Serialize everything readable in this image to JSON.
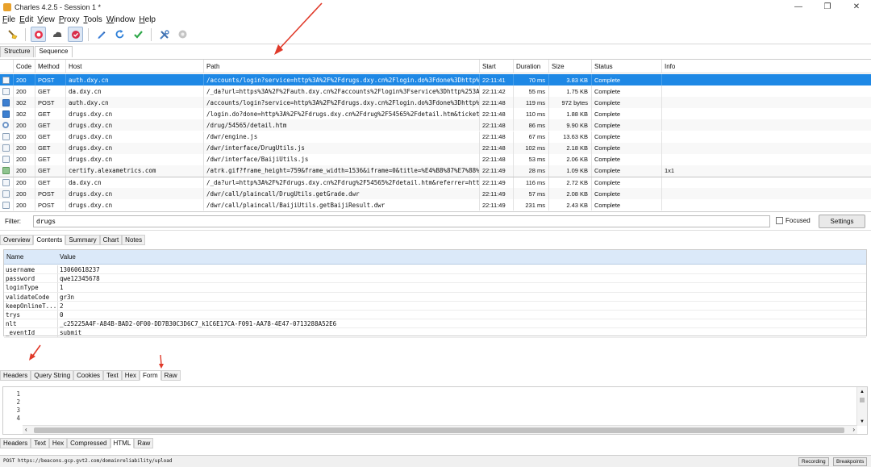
{
  "window": {
    "title": "Charles 4.2.5 - Session 1 *"
  },
  "menu": [
    {
      "key": "F",
      "rest": "ile"
    },
    {
      "key": "E",
      "rest": "dit"
    },
    {
      "key": "V",
      "rest": "iew"
    },
    {
      "key": "P",
      "rest": "roxy"
    },
    {
      "key": "T",
      "rest": "ools"
    },
    {
      "key": "W",
      "rest": "indow"
    },
    {
      "key": "H",
      "rest": "elp"
    }
  ],
  "toolbar": {
    "icons": [
      "broom-icon",
      "record-icon",
      "throttle-icon",
      "breakpoint-icon",
      "pen-icon",
      "refresh-icon",
      "check-icon",
      "tools-icon",
      "settings-icon"
    ]
  },
  "view_tabs": [
    "Structure",
    "Sequence"
  ],
  "sequence": {
    "columns": [
      "Code",
      "Method",
      "Host",
      "Path",
      "Start",
      "Duration",
      "Size",
      "Status",
      "Info"
    ],
    "rows": [
      {
        "icon": "doc",
        "code": "200",
        "method": "POST",
        "host": "auth.dxy.cn",
        "path": "/accounts/login?service=http%3A%2F%2Fdrugs.dxy.cn%2Flogin.do%3Fdone%3Dhttp%",
        "start": "22:11:41",
        "duration": "70 ms",
        "size": "3.83 KB",
        "status": "Complete",
        "info": ""
      },
      {
        "icon": "doc",
        "code": "200",
        "method": "GET",
        "host": "da.dxy.cn",
        "path": "/_da?url=https%3A%2F%2Fauth.dxy.cn%2Faccounts%2Flogin%3Fservice%3Dhttp%253A",
        "start": "22:11:42",
        "duration": "55 ms",
        "size": "1.75 KB",
        "status": "Complete",
        "info": ""
      },
      {
        "icon": "redirect",
        "code": "302",
        "method": "POST",
        "host": "auth.dxy.cn",
        "path": "/accounts/login?service=http%3A%2F%2Fdrugs.dxy.cn%2Flogin.do%3Fdone%3Dhttp%",
        "start": "22:11:48",
        "duration": "119 ms",
        "size": "972 bytes",
        "status": "Complete",
        "info": ""
      },
      {
        "icon": "redirect",
        "code": "302",
        "method": "GET",
        "host": "drugs.dxy.cn",
        "path": "/login.do?done=http%3A%2F%2Fdrugs.dxy.cn%2Fdrug%2F54565%2Fdetail.htm&ticket=",
        "start": "22:11:48",
        "duration": "110 ms",
        "size": "1.88 KB",
        "status": "Complete",
        "info": ""
      },
      {
        "icon": "gear",
        "code": "200",
        "method": "GET",
        "host": "drugs.dxy.cn",
        "path": "/drug/54565/detail.htm",
        "start": "22:11:48",
        "duration": "86 ms",
        "size": "9.90 KB",
        "status": "Complete",
        "info": ""
      },
      {
        "icon": "doc",
        "code": "200",
        "method": "GET",
        "host": "drugs.dxy.cn",
        "path": "/dwr/engine.js",
        "start": "22:11:48",
        "duration": "67 ms",
        "size": "13.63 KB",
        "status": "Complete",
        "info": ""
      },
      {
        "icon": "doc",
        "code": "200",
        "method": "GET",
        "host": "drugs.dxy.cn",
        "path": "/dwr/interface/DrugUtils.js",
        "start": "22:11:48",
        "duration": "102 ms",
        "size": "2.18 KB",
        "status": "Complete",
        "info": ""
      },
      {
        "icon": "doc",
        "code": "200",
        "method": "GET",
        "host": "drugs.dxy.cn",
        "path": "/dwr/interface/BaijiUtils.js",
        "start": "22:11:48",
        "duration": "53 ms",
        "size": "2.06 KB",
        "status": "Complete",
        "info": ""
      },
      {
        "icon": "image",
        "code": "200",
        "method": "GET",
        "host": "certify.alexametrics.com",
        "path": "/atrk.gif?frame_height=759&frame_width=1536&iframe=0&title=%E4%B8%87%E7%88%",
        "start": "22:11:49",
        "duration": "28 ms",
        "size": "1.09 KB",
        "status": "Complete",
        "info": "1x1"
      },
      {
        "icon": "doc",
        "code": "200",
        "method": "GET",
        "host": "da.dxy.cn",
        "path": "/_da?url=http%3A%2F%2Fdrugs.dxy.cn%2Fdrug%2F54565%2Fdetail.htm&referrer=http",
        "start": "22:11:49",
        "duration": "116 ms",
        "size": "2.72 KB",
        "status": "Complete",
        "info": ""
      },
      {
        "icon": "doc",
        "code": "200",
        "method": "POST",
        "host": "drugs.dxy.cn",
        "path": "/dwr/call/plaincall/DrugUtils.getGrade.dwr",
        "start": "22:11:49",
        "duration": "57 ms",
        "size": "2.08 KB",
        "status": "Complete",
        "info": ""
      },
      {
        "icon": "doc",
        "code": "200",
        "method": "POST",
        "host": "drugs.dxy.cn",
        "path": "/dwr/call/plaincall/BaijiUtils.getBaijiResult.dwr",
        "start": "22:11:49",
        "duration": "231 ms",
        "size": "2.43 KB",
        "status": "Complete",
        "info": ""
      }
    ]
  },
  "filter": {
    "label": "Filter:",
    "value": "drugs",
    "focused_label": "Focused",
    "settings_label": "Settings"
  },
  "detail_tabs": [
    "Overview",
    "Contents",
    "Summary",
    "Chart",
    "Notes"
  ],
  "form": {
    "headers": [
      "Name",
      "Value"
    ],
    "rows": [
      {
        "name": "username",
        "value": "13060618237"
      },
      {
        "name": "password",
        "value": "qwe12345678"
      },
      {
        "name": "loginType",
        "value": "1"
      },
      {
        "name": "validateCode",
        "value": "gr3n"
      },
      {
        "name": "keepOnlineT...",
        "value": "2"
      },
      {
        "name": "trys",
        "value": "0"
      },
      {
        "name": "nlt",
        "value": "_c25225A4F-A84B-BAD2-0F00-DD7B30C3D6C7_k1C6E17CA-F091-AA78-4E47-0713288A52E6"
      },
      {
        "name": "_eventId",
        "value": "submit"
      }
    ]
  },
  "request_tabs": [
    "Headers",
    "Query String",
    "Cookies",
    "Text",
    "Hex",
    "Form",
    "Raw"
  ],
  "response": {
    "line_numbers": [
      "1",
      "2",
      "3",
      "4"
    ]
  },
  "response_tabs": [
    "Headers",
    "Text",
    "Hex",
    "Compressed",
    "HTML",
    "Raw"
  ],
  "statusbar": {
    "message": "POST https://beacons.gcp.gvt2.com/domainreliability/upload",
    "recording_label": "Recording",
    "breakpoints_label": "Breakpoints"
  },
  "colors": {
    "selection": "#1e88e5",
    "form_header": "#dbe9f9",
    "annotation": "#e03a2a"
  }
}
